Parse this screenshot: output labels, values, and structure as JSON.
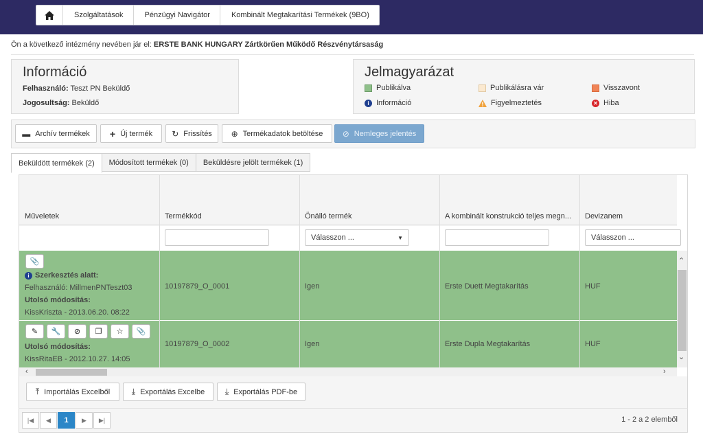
{
  "breadcrumb": {
    "items": [
      "Szolgáltatások",
      "Pénzügyi Navigátor",
      "Kombinált Megtakarítási Termékek (9BO)"
    ]
  },
  "institution": {
    "prefix": "Ön a következő intézmény nevében jár el:",
    "name": "ERSTE BANK HUNGARY Zártkörűen Működő Részvénytársaság"
  },
  "info": {
    "title": "Információ",
    "user_label": "Felhasználó:",
    "user_value": "Teszt PN Beküldő",
    "role_label": "Jogosultság:",
    "role_value": "Beküldő"
  },
  "legend": {
    "title": "Jelmagyarázat",
    "items": [
      {
        "label": "Publikálva",
        "color": "#8fc08a"
      },
      {
        "label": "Publikálásra vár",
        "color": "#fbe9d0"
      },
      {
        "label": "Visszavont",
        "color": "#f08457"
      },
      {
        "label": "Információ",
        "icon": "info-icon"
      },
      {
        "label": "Figyelmeztetés",
        "icon": "warning-icon"
      },
      {
        "label": "Hiba",
        "icon": "error-icon"
      }
    ]
  },
  "toolbar": {
    "archive": "Archív termékek",
    "new": "Új termék",
    "refresh": "Frissítés",
    "load": "Termékadatok betöltése",
    "null_report": "Nemleges jelentés"
  },
  "tabs": [
    "Beküldött termékek (2)",
    "Módosított termékek (0)",
    "Beküldésre jelölt termékek (1)"
  ],
  "grid": {
    "columns": [
      "Műveletek",
      "Termékkód",
      "Önálló termék",
      "A kombinált konstrukció teljes megn...",
      "Devizanem"
    ],
    "select_placeholder": "Válasszon ...",
    "rows": [
      {
        "editing_label": "Szerkesztés alatt:",
        "editing_user": "Felhasználó: MillmenPNTeszt03",
        "modified_label": "Utolsó módosítás:",
        "modified_value": "KissKriszta - 2013.06.20. 08:22",
        "code": "10197879_O_0001",
        "standalone": "Igen",
        "name": "Erste Duett Megtakarítás",
        "currency": "HUF"
      },
      {
        "modified_label": "Utolsó módosítás:",
        "modified_value": "KissRitaEB - 2012.10.27. 14:05",
        "code": "10197879_O_0002",
        "standalone": "Igen",
        "name": "Erste Dupla Megtakarítás",
        "currency": "HUF"
      }
    ]
  },
  "footer": {
    "import": "Importálás Excelből",
    "export_excel": "Exportálás Excelbe",
    "export_pdf": "Exportálás PDF-be"
  },
  "pager": {
    "current": "1",
    "info": "1 - 2 a 2 elemből"
  }
}
